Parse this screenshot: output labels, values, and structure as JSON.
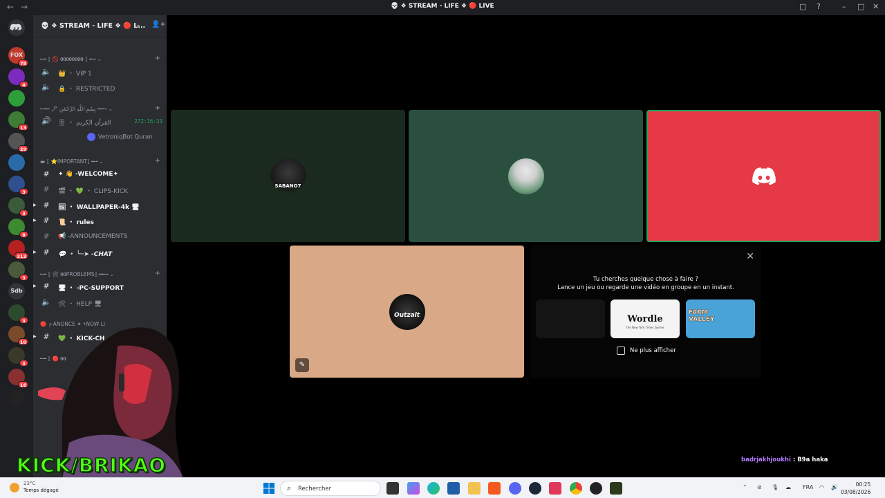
{
  "window": {
    "title": "💀 ❖ STREAM - LIFE ❖ 🔴 LIVE",
    "back_glyph": "←",
    "forward_glyph": "→",
    "controls": [
      "▢",
      "?",
      "–",
      "□",
      "✕"
    ]
  },
  "servers": [
    {
      "label": "FOX",
      "badge": "78",
      "color": "#c0392b"
    },
    {
      "label": "",
      "badge": "4",
      "color": "#7b2cbf"
    },
    {
      "label": "",
      "badge": "",
      "color": "#2e9e3a"
    },
    {
      "label": "",
      "badge": "13",
      "color": "#3d7d35"
    },
    {
      "label": "",
      "badge": "29",
      "color": "#555555"
    },
    {
      "label": "",
      "badge": "",
      "color": "#2a6aa8"
    },
    {
      "label": "",
      "badge": "3",
      "color": "#2f4f8f"
    },
    {
      "label": "",
      "badge": "3",
      "color": "#3a5a3a"
    },
    {
      "label": "",
      "badge": "8",
      "color": "#3d8a30"
    },
    {
      "label": "",
      "badge": "313",
      "color": "#b52020"
    },
    {
      "label": "",
      "badge": "3",
      "color": "#4a5a3a"
    },
    {
      "label": "Sdb",
      "badge": "",
      "color": "#313338"
    },
    {
      "label": "",
      "badge": "3",
      "color": "#2e4a2e"
    },
    {
      "label": "",
      "badge": "10",
      "color": "#7a4a2a"
    },
    {
      "label": "",
      "badge": "3",
      "color": "#3a3a2a"
    },
    {
      "label": "",
      "badge": "16",
      "color": "#8a3030"
    },
    {
      "label": "",
      "badge": "",
      "color": "#222222"
    }
  ],
  "guild": {
    "name": "💀 ❖ STREAM - LIFE ❖ 🔴 L...",
    "chevron": "⌄",
    "invite_icon": "👤+"
  },
  "channels": {
    "cat1": "╾━ ⟦ 🚫 𝟎𝟎𝟎𝟎𝟎𝟎𝟎𝟎 ⟧ ━╼ ⌄",
    "vip": "👑 ・ VIP 1",
    "restricted": "🔒 ・ RESTRICTED",
    "cat2": "╾━━ 🖊 بِسْمِ اللَّهِ الرَّحْمَٰنِ ━━╼ ⌄",
    "quran": "🎚 ・ القرآن الكريم",
    "quran_timer": "272:16:33",
    "quran_bot": "VetroniqBot Quran",
    "cat3": "▬ ⟦ ⭐IMPORTANT⟧ ━╼ ⌄",
    "welcome": "✦ 👋 -WELCOME✦",
    "clips": "🎬 ・ 💚 ・ CLIPS-KICK",
    "wallpaper": "🖼 ・ WALLPAPER-4k 🖥",
    "rules": "📜 ・ rules",
    "announcements": "📢 -ANNOUNCEMENTS",
    "chat": "💬 ・ ╰─➤ -CHAT",
    "cat4": "╾━ ⟦ 🛠 𝟎𝟎PROBLEMS⟧ ━━╼ ⌄",
    "pc_support": "🖥 ・ -PC-SUPPORT",
    "help": "🛠 ・ HELP 🖥",
    "cat5": "🔴 ╒ ANONCE ✦ •NOW LI",
    "kick": "💚 ・ KICK-CH",
    "cat6": "╾━ ⟦ 🔴 𝟎𝟎"
  },
  "tiles": [
    {
      "name": "SABANO7",
      "bg": "#1a2a1f"
    },
    {
      "name": "",
      "bg": "#2a4f3f"
    },
    {
      "name": "",
      "bg": "#e63946"
    },
    {
      "name": "Outzalt",
      "bg": "#d8a887"
    }
  ],
  "activity": {
    "close": "✕",
    "line1": "Tu cherches quelque chose à faire ?",
    "line2": "Lance un jeu ou regarde une vidéo en groupe en un instant.",
    "cards": [
      {
        "label": "",
        "bg": "#141414"
      },
      {
        "label": "Wordle",
        "sub": "The New York Times Games",
        "bg": "#f4f4f4"
      },
      {
        "label": "FARM VALLEY",
        "bg": "#4aa3d8"
      }
    ],
    "checkbox_label": "Ne plus afficher"
  },
  "overlay": {
    "kick_text": "KICK/BRIKAO",
    "chat_user": "badrjakhjoukhi",
    "chat_sep": " : ",
    "chat_msg": "B9a haka"
  },
  "taskbar": {
    "weather_temp": "23°C",
    "weather_text": "Temps dégagé",
    "search_placeholder": "Rechercher",
    "lang": "FRA",
    "time": "00:25",
    "date": "03/08/2026"
  }
}
